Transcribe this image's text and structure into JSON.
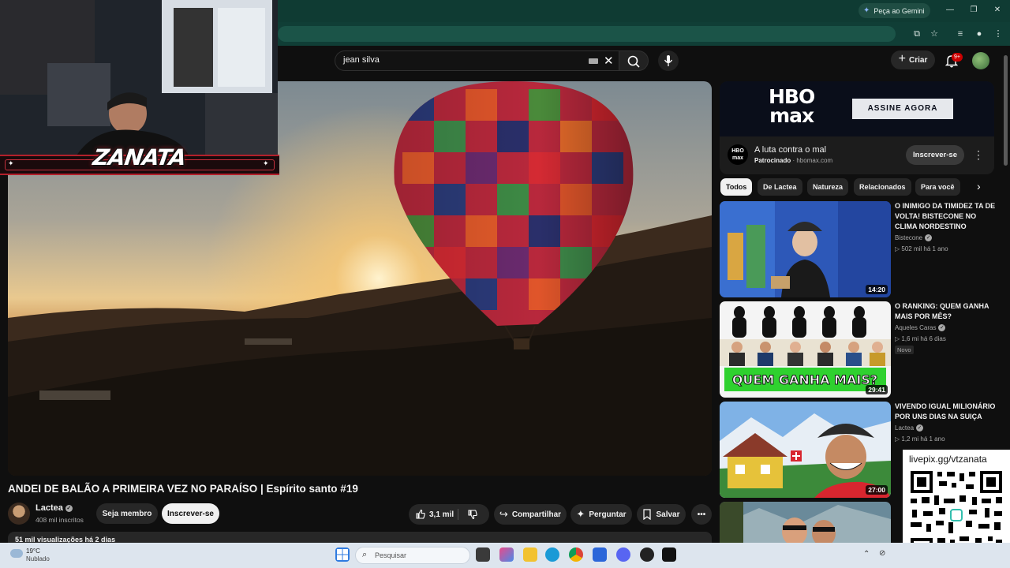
{
  "browser": {
    "gemini_label": "Peça ao Gemini"
  },
  "youtube": {
    "search_query": "jean silva",
    "create_label": "Criar",
    "notification_count": "9+"
  },
  "overlay": {
    "streamer_logo": "ZANATA",
    "donation_link": "livepix.gg/vtzanata"
  },
  "video": {
    "title": "ANDEI DE BALÃO A PRIMEIRA VEZ NO PARAÍSO | Espírito santo #19",
    "channel_name": "Lactea",
    "subscribers": "408 mil inscritos",
    "member_label": "Seja membro",
    "subscribe_label": "Inscrever-se",
    "likes": "3,1 mil",
    "share_label": "Compartilhar",
    "ask_label": "Perguntar",
    "save_label": "Salvar",
    "views_date": "51 mil visualizações  há 2 dias"
  },
  "ad": {
    "logo_line1": "HBO",
    "logo_line2": "max",
    "cta": "ASSINE AGORA",
    "title": "A luta contra o mal",
    "sponsored": "Patrocinado",
    "domain": "· hbomax.com",
    "subscribe_label": "Inscrever-se",
    "small_logo_line1": "HBO",
    "small_logo_line2": "max"
  },
  "chips": [
    "Todos",
    "De Lactea",
    "Natureza",
    "Relacionados",
    "Para você"
  ],
  "recommendations": [
    {
      "title": "O INIMIGO DA TIMIDEZ TA DE VOLTA! BISTECONE NO CLIMA NORDESTINO",
      "channel": "Bistecone",
      "stats": "▷ 502 mil   há 1 ano",
      "duration": "14:20",
      "badge": ""
    },
    {
      "title": "O RANKING: QUEM GANHA MAIS POR MÊS?",
      "channel": "Aqueles Caras",
      "stats": "▷ 1,6 mi   há 6 dias",
      "duration": "29:41",
      "badge": "Novo",
      "thumb_text": "QUEM GANHA MAIS?"
    },
    {
      "title": "VIVENDO IGUAL MILIONÁRIO POR UNS DIAS NA SUIÇA",
      "channel": "Lactea",
      "stats": "▷ 1,2 mi   há 1 ano",
      "duration": "27:00",
      "badge": ""
    }
  ],
  "taskbar": {
    "temperature": "19°C",
    "weather": "Nublado",
    "search_placeholder": "Pesquisar"
  },
  "colors": {
    "chrome_accent": "#0f3b33",
    "yt_background": "#0f0f0f",
    "overlay_red": "#b3202b",
    "thumb_green_banner": "#2fd12f"
  }
}
